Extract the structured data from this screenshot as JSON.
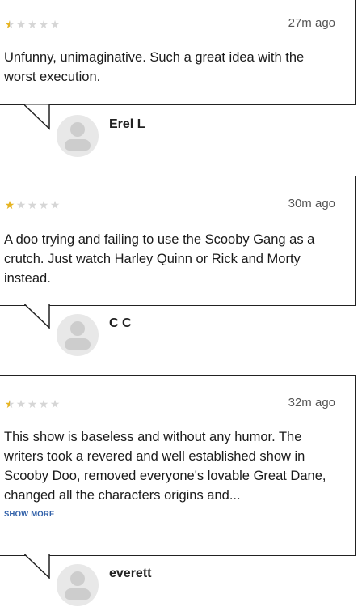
{
  "reviews": [
    {
      "rating": 0.5,
      "time": "27m ago",
      "text": "Unfunny, unimaginative. Such a great idea with the worst execution.",
      "show_more": "",
      "author": "Erel L"
    },
    {
      "rating": 1,
      "time": "30m ago",
      "text": "A doo trying and failing to use the Scooby Gang as a crutch. Just watch Harley Quinn or Rick and Morty instead.",
      "show_more": "",
      "author": "C C"
    },
    {
      "rating": 0.5,
      "time": "32m ago",
      "text": "This show is baseless and without any humor. The writers took a revered and well established show in Scooby Doo, removed everyone's lovable Great Dane, changed all the characters origins and...",
      "show_more": "SHOW MORE",
      "author": "everett"
    }
  ],
  "colors": {
    "star_filled": "#e6b422",
    "star_empty": "#d6d6d6",
    "link": "#2f5fa8"
  },
  "icons": {
    "star": "star-icon",
    "avatar": "user-avatar-icon"
  }
}
